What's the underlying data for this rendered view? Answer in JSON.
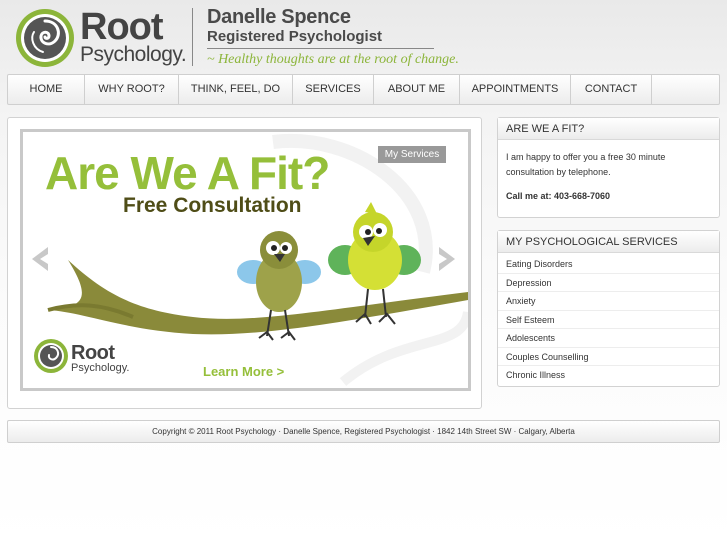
{
  "header": {
    "logo": {
      "line1": "Root",
      "line2": "Psychology."
    },
    "name": "Danelle Spence",
    "title": "Registered Psychologist",
    "tagline": "~ Healthy thoughts are at the root of change."
  },
  "nav": {
    "items": [
      {
        "label": "HOME"
      },
      {
        "label": "WHY ROOT?"
      },
      {
        "label": "THINK, FEEL, DO"
      },
      {
        "label": "SERVICES"
      },
      {
        "label": "ABOUT ME"
      },
      {
        "label": "APPOINTMENTS"
      },
      {
        "label": "CONTACT"
      }
    ]
  },
  "slider": {
    "tab_label": "My Services",
    "headline": "Are We A Fit?",
    "subheadline": "Free Consultation",
    "logo": {
      "line1": "Root",
      "line2": "Psychology."
    },
    "cta": "Learn More >",
    "prev_icon": "chevron-left-icon",
    "next_icon": "chevron-right-icon"
  },
  "fit_box": {
    "title": "ARE WE A FIT?",
    "body": "I am happy to offer you a free 30 minute consultation by telephone.",
    "call": "Call me at: 403-668-7060"
  },
  "services_box": {
    "title": "MY PSYCHOLOGICAL SERVICES",
    "items": [
      "Eating Disorders",
      "Depression",
      "Anxiety",
      "Self Esteem",
      "Adolescents",
      "Couples Counselling",
      "Chronic Illness"
    ]
  },
  "footer": {
    "text": "Copyright © 2011 Root Psychology · Danelle Spence, Registered Psychologist · 1842 14th Street SW · Calgary, Alberta"
  },
  "colors": {
    "brand_green": "#95bf3a",
    "dark_olive": "#4f4d17",
    "text": "#333333",
    "border": "#d2d2d2"
  }
}
